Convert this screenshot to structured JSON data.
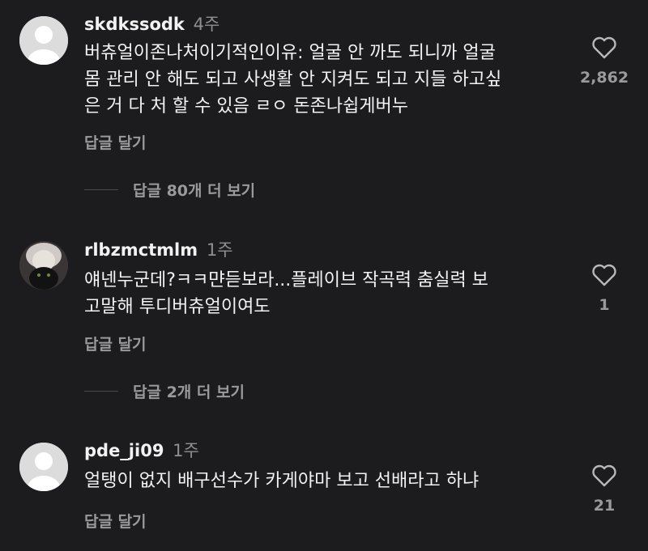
{
  "comments": [
    {
      "username": "skdkssodk",
      "time": "4주",
      "text": "버츄얼이존나처이기적인이유: 얼굴 안 까도 되니까 얼굴\n몸 관리 안 해도 되고 사생활 안 지켜도 되고 지들 하고싶\n은 거 다 처 할 수 있음 ㄹㅇ 돈존나쉽게버누",
      "reply_label": "답글 달기",
      "like_count": "2,862",
      "view_replies": "답글 80개 더 보기"
    },
    {
      "username": "rlbzmctmlm",
      "time": "1주",
      "text": "얘넨누군데?ㅋㅋ먄듣보라...플레이브 작곡력 춤실력 보\n고말해 투디버츄얼이여도",
      "reply_label": "답글 달기",
      "like_count": "1",
      "view_replies": "답글 2개 더 보기"
    },
    {
      "username": "pde_ji09",
      "time": "1주",
      "text": "얼탱이 없지 배구선수가 카게야마 보고 선배라고 하냐",
      "reply_label": "답글 달기",
      "like_count": "21"
    }
  ],
  "icons": {
    "avatar_default": "default-avatar-icon",
    "avatar_photo": "profile-photo-avatar",
    "like": "heart-outline-icon"
  },
  "colors": {
    "background": "#1c1c1e",
    "text": "#f2f2f2",
    "secondary": "#8e8e93"
  }
}
